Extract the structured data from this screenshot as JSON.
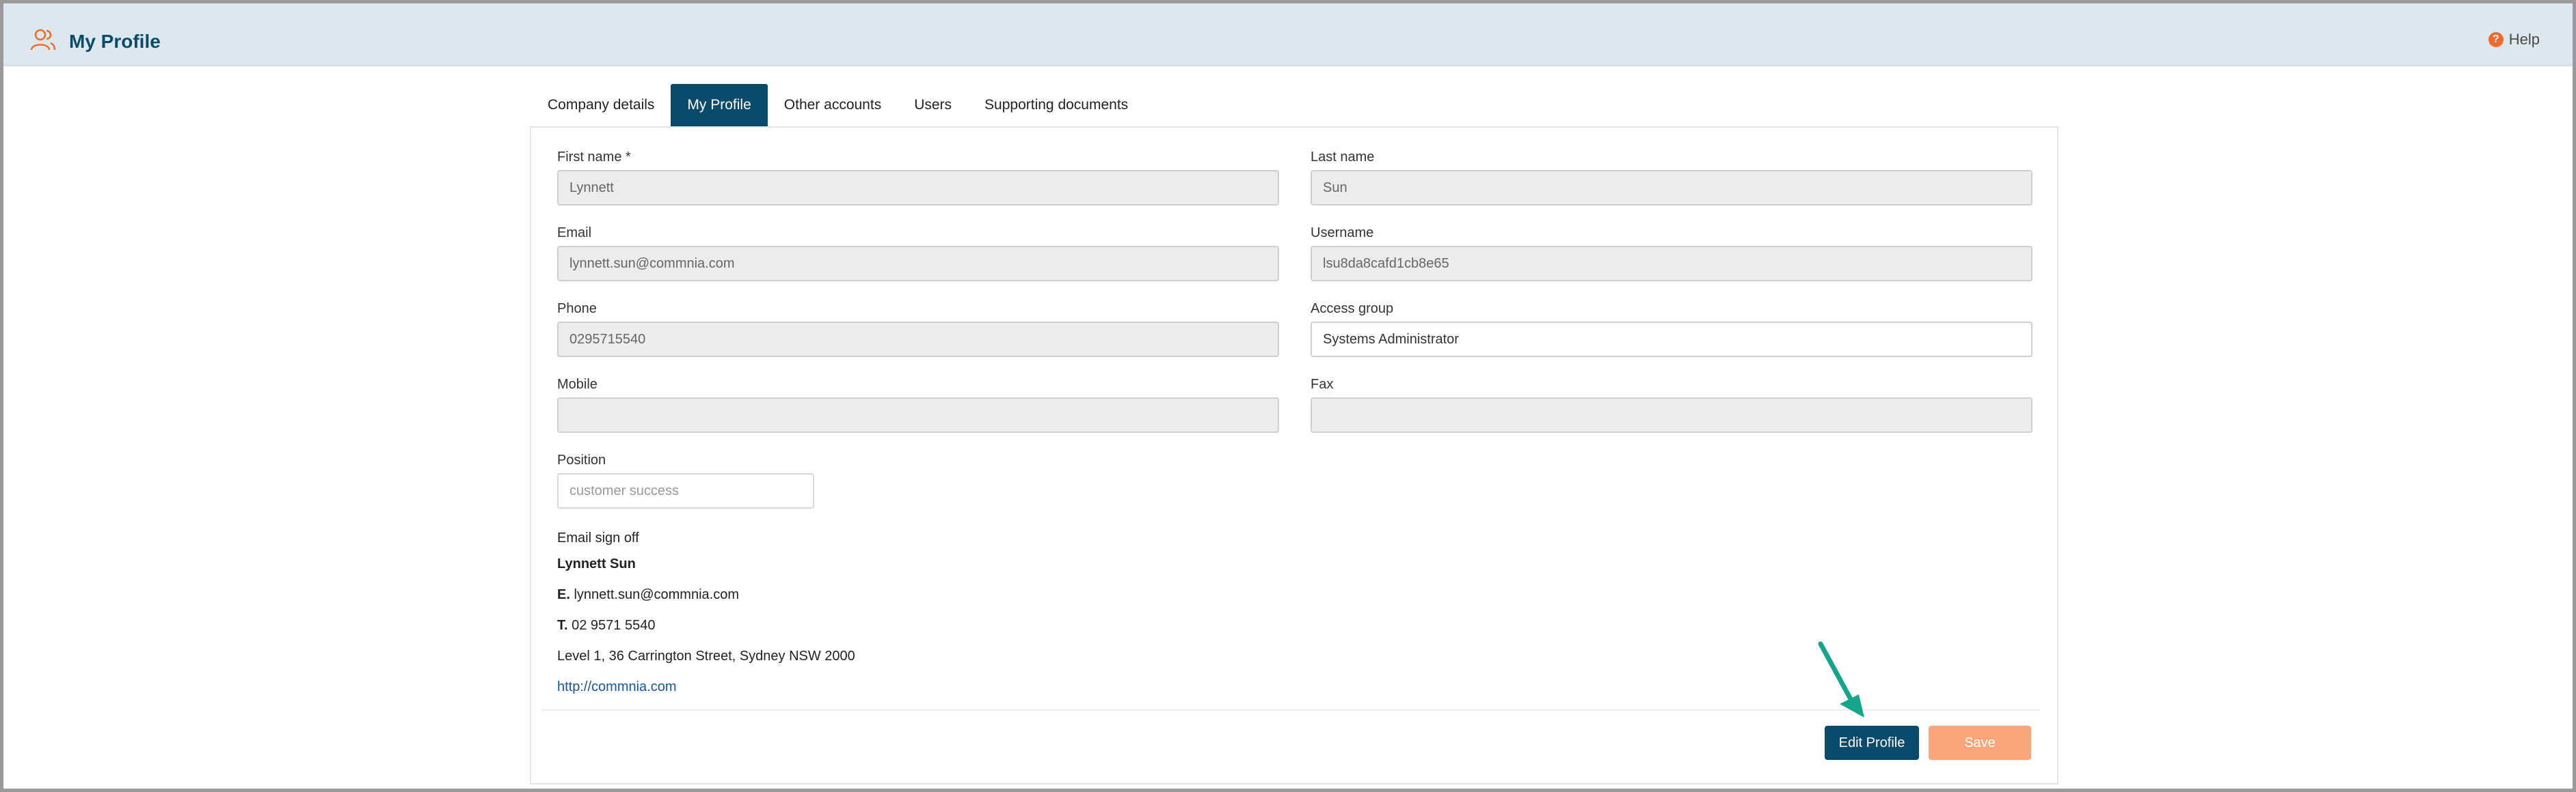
{
  "header": {
    "title": "My Profile",
    "help_label": "Help",
    "accent_color": "#f06a2b",
    "brand_color": "#0a4a6a"
  },
  "tabs": [
    {
      "label": "Company details",
      "active": false
    },
    {
      "label": "My Profile",
      "active": true
    },
    {
      "label": "Other accounts",
      "active": false
    },
    {
      "label": "Users",
      "active": false
    },
    {
      "label": "Supporting documents",
      "active": false
    }
  ],
  "form": {
    "first_name": {
      "label": "First name *",
      "value": "Lynnett"
    },
    "last_name": {
      "label": "Last name",
      "value": "Sun"
    },
    "email": {
      "label": "Email",
      "value": "lynnett.sun@commnia.com"
    },
    "username": {
      "label": "Username",
      "value": "lsu8da8cafd1cb8e65"
    },
    "phone": {
      "label": "Phone",
      "value": "0295715540"
    },
    "access_group": {
      "label": "Access group",
      "value": "Systems Administrator"
    },
    "mobile": {
      "label": "Mobile",
      "value": ""
    },
    "fax": {
      "label": "Fax",
      "value": ""
    },
    "position": {
      "label": "Position",
      "placeholder": "customer success"
    }
  },
  "signoff": {
    "label": "Email sign off",
    "name": "Lynnett Sun",
    "email_prefix": "E.",
    "email": "lynnett.sun@commnia.com",
    "phone_prefix": "T.",
    "phone": "02 9571 5540",
    "address": "Level 1, 36 Carrington Street, Sydney NSW 2000",
    "website": "http://commnia.com"
  },
  "buttons": {
    "edit_label": "Edit Profile",
    "save_label": "Save"
  }
}
